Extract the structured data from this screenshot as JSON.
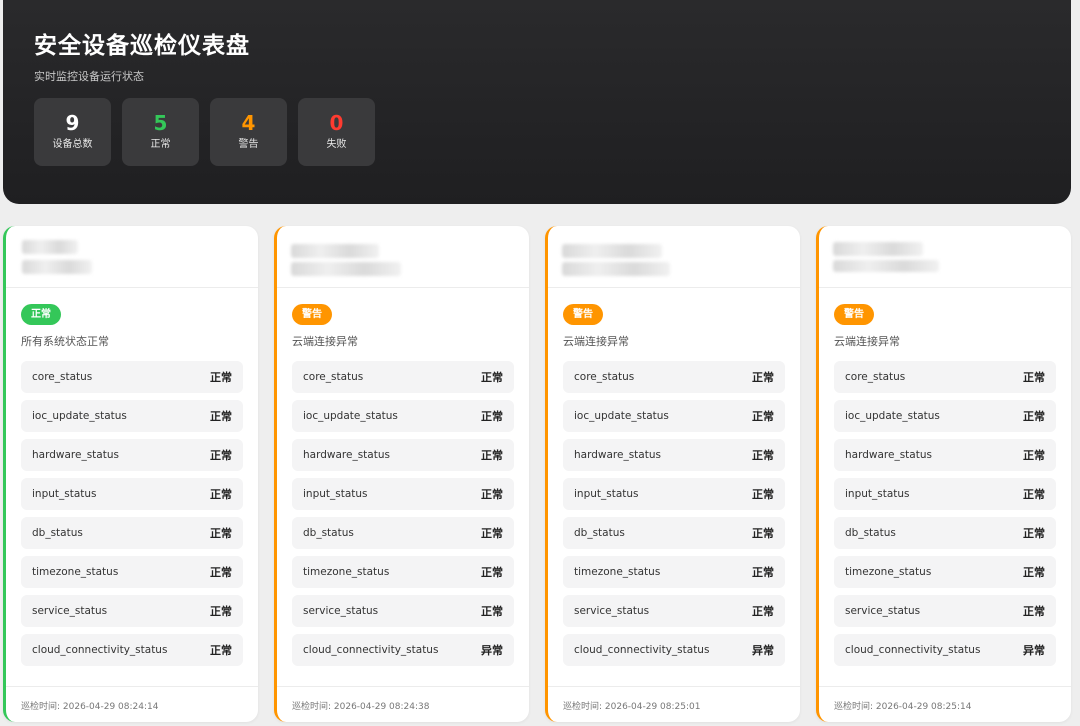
{
  "header": {
    "title": "安全设备巡检仪表盘",
    "subtitle": "实时监控设备运行状态"
  },
  "stats": [
    {
      "value": "9",
      "label": "设备总数",
      "color": "#ffffff"
    },
    {
      "value": "5",
      "label": "正常",
      "color": "#34c759"
    },
    {
      "value": "4",
      "label": "警告",
      "color": "#ff9500"
    },
    {
      "value": "0",
      "label": "失败",
      "color": "#ff3b30"
    }
  ],
  "colors": {
    "ok": "#34c759",
    "warn": "#ff9500",
    "fail": "#ff3b30"
  },
  "cards": [
    {
      "badge": "正常",
      "summary": "所有系统状态正常",
      "rows": [
        {
          "key": "core_status",
          "value": "正常"
        },
        {
          "key": "ioc_update_status",
          "value": "正常"
        },
        {
          "key": "hardware_status",
          "value": "正常"
        },
        {
          "key": "input_status",
          "value": "正常"
        },
        {
          "key": "db_status",
          "value": "正常"
        },
        {
          "key": "timezone_status",
          "value": "正常"
        },
        {
          "key": "service_status",
          "value": "正常"
        },
        {
          "key": "cloud_connectivity_status",
          "value": "正常"
        }
      ],
      "footer": "巡检时间: 2026-04-29 08:24:14"
    },
    {
      "badge": "警告",
      "summary": "云端连接异常",
      "rows": [
        {
          "key": "core_status",
          "value": "正常"
        },
        {
          "key": "ioc_update_status",
          "value": "正常"
        },
        {
          "key": "hardware_status",
          "value": "正常"
        },
        {
          "key": "input_status",
          "value": "正常"
        },
        {
          "key": "db_status",
          "value": "正常"
        },
        {
          "key": "timezone_status",
          "value": "正常"
        },
        {
          "key": "service_status",
          "value": "正常"
        },
        {
          "key": "cloud_connectivity_status",
          "value": "异常"
        }
      ],
      "footer": "巡检时间: 2026-04-29 08:24:38"
    },
    {
      "badge": "警告",
      "summary": "云端连接异常",
      "rows": [
        {
          "key": "core_status",
          "value": "正常"
        },
        {
          "key": "ioc_update_status",
          "value": "正常"
        },
        {
          "key": "hardware_status",
          "value": "正常"
        },
        {
          "key": "input_status",
          "value": "正常"
        },
        {
          "key": "db_status",
          "value": "正常"
        },
        {
          "key": "timezone_status",
          "value": "正常"
        },
        {
          "key": "service_status",
          "value": "正常"
        },
        {
          "key": "cloud_connectivity_status",
          "value": "异常"
        }
      ],
      "footer": "巡检时间: 2026-04-29 08:25:01"
    },
    {
      "badge": "警告",
      "summary": "云端连接异常",
      "rows": [
        {
          "key": "core_status",
          "value": "正常"
        },
        {
          "key": "ioc_update_status",
          "value": "正常"
        },
        {
          "key": "hardware_status",
          "value": "正常"
        },
        {
          "key": "input_status",
          "value": "正常"
        },
        {
          "key": "db_status",
          "value": "正常"
        },
        {
          "key": "timezone_status",
          "value": "正常"
        },
        {
          "key": "service_status",
          "value": "正常"
        },
        {
          "key": "cloud_connectivity_status",
          "value": "异常"
        }
      ],
      "footer": "巡检时间: 2026-04-29 08:25:14"
    }
  ]
}
